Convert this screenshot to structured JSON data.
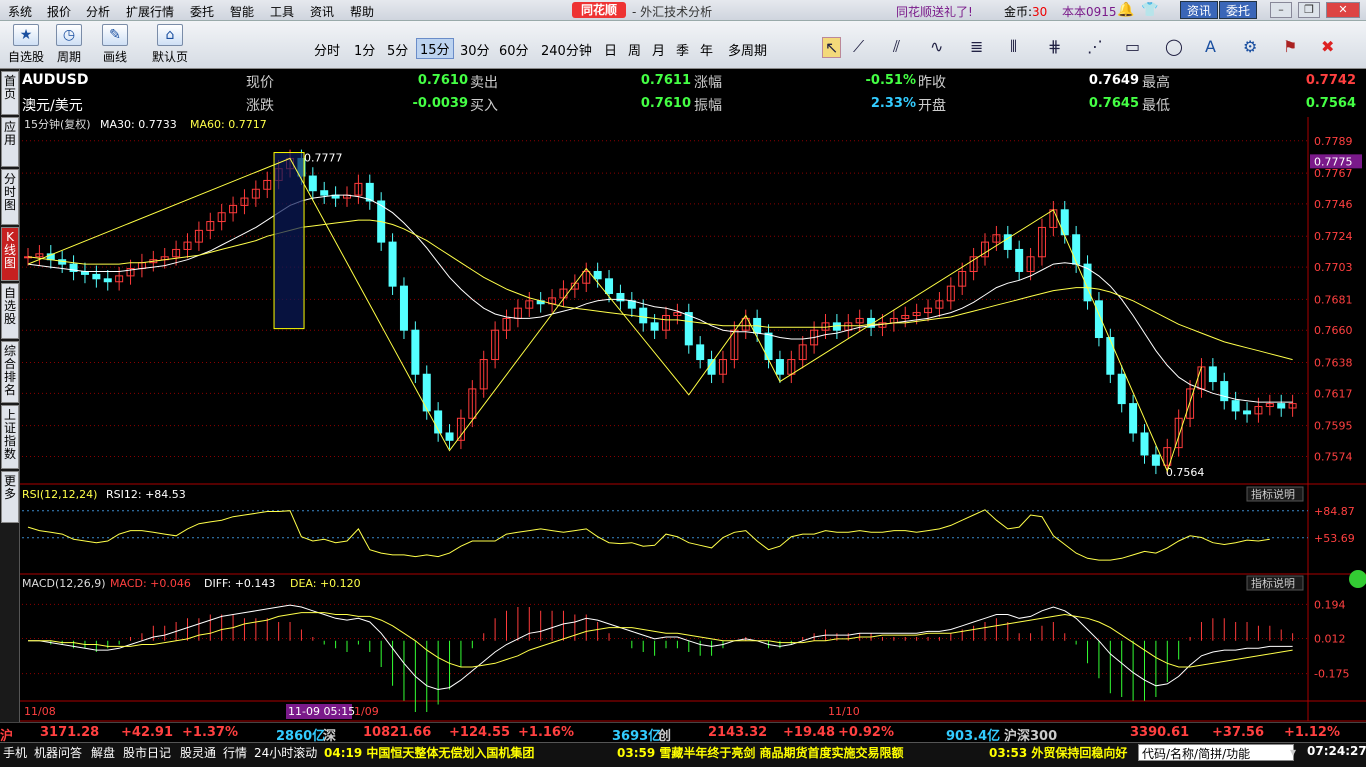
{
  "menu": {
    "items": [
      "系统",
      "报价",
      "分析",
      "扩展行情",
      "委托",
      "智能",
      "工具",
      "资讯",
      "帮助"
    ],
    "logo": "同花顺",
    "title": "- 外汇技术分析",
    "promo": "同花顺送礼了!",
    "gold_label": "金币:",
    "gold_value": "30",
    "version": "本本0915",
    "btn_news": "资讯",
    "btn_trade": "委托"
  },
  "toolbar": {
    "big": [
      {
        "label": "自选股",
        "icon": "star-icon"
      },
      {
        "label": "周期",
        "icon": "clock-icon"
      },
      {
        "label": "画线",
        "icon": "pencil-icon"
      },
      {
        "label": "默认页",
        "icon": "home-icon"
      }
    ],
    "periods": [
      "分时",
      "1分",
      "5分",
      "15分",
      "30分",
      "60分",
      "240分钟",
      "日",
      "周",
      "月",
      "季",
      "年",
      "多周期"
    ],
    "selected_period": "15分"
  },
  "sidebar": [
    "首页",
    "应用",
    "分时图",
    "K线图",
    "自选股",
    "综合排名",
    "上证指数",
    "更多"
  ],
  "quote": {
    "symbol": "AUDUSD",
    "name": "澳元/美元",
    "row1": [
      {
        "label": "现价",
        "value": "0.7610"
      },
      {
        "label": "卖出",
        "value": "0.7611"
      },
      {
        "label": "涨幅",
        "value": "-0.51%"
      },
      {
        "label": "昨收",
        "value": "0.7649"
      },
      {
        "label": "最高",
        "value": "0.7742"
      }
    ],
    "row2": [
      {
        "label": "涨跌",
        "value": "-0.0039"
      },
      {
        "label": "买入",
        "value": "0.7610"
      },
      {
        "label": "振幅",
        "value": "2.33%"
      },
      {
        "label": "开盘",
        "value": "0.7645"
      },
      {
        "label": "最低",
        "value": "0.7564"
      }
    ]
  },
  "chart_data": {
    "type": "candlestick",
    "main": {
      "title": "15分钟(复权)",
      "ma30_label": "MA30: 0.7733",
      "ma60_label": "MA60: 0.7717",
      "yticks": [
        "0.7789",
        "0.7767",
        "0.7746",
        "0.7724",
        "0.7703",
        "0.7681",
        "0.7660",
        "0.7638",
        "0.7617",
        "0.7595",
        "0.7574"
      ],
      "ylim": [
        0.756,
        0.7795
      ],
      "current_price_tag": "0.7775",
      "high_label": "0.7777",
      "low_label": "0.7564",
      "closes": [
        0.771,
        0.7712,
        0.7708,
        0.7705,
        0.77,
        0.7698,
        0.7695,
        0.7693,
        0.7697,
        0.7702,
        0.7706,
        0.7708,
        0.771,
        0.7715,
        0.772,
        0.7728,
        0.7734,
        0.774,
        0.7745,
        0.775,
        0.7756,
        0.7762,
        0.777,
        0.7777,
        0.7765,
        0.7755,
        0.7752,
        0.775,
        0.7752,
        0.776,
        0.7748,
        0.772,
        0.769,
        0.766,
        0.763,
        0.7605,
        0.759,
        0.7585,
        0.76,
        0.762,
        0.764,
        0.766,
        0.7668,
        0.7675,
        0.768,
        0.7678,
        0.7682,
        0.7688,
        0.7692,
        0.77,
        0.7695,
        0.7685,
        0.768,
        0.7675,
        0.7665,
        0.766,
        0.767,
        0.7672,
        0.765,
        0.764,
        0.763,
        0.764,
        0.766,
        0.7668,
        0.7658,
        0.764,
        0.763,
        0.764,
        0.765,
        0.766,
        0.7665,
        0.766,
        0.7665,
        0.7668,
        0.7662,
        0.7665,
        0.7668,
        0.767,
        0.7672,
        0.7675,
        0.768,
        0.769,
        0.77,
        0.771,
        0.772,
        0.7725,
        0.7715,
        0.77,
        0.771,
        0.773,
        0.7742,
        0.7725,
        0.7705,
        0.768,
        0.7655,
        0.763,
        0.761,
        0.759,
        0.7575,
        0.7568,
        0.758,
        0.76,
        0.762,
        0.7635,
        0.7625,
        0.7612,
        0.7605,
        0.7603,
        0.7608,
        0.761,
        0.7607,
        0.761
      ],
      "ma30": [
        0.7705,
        0.7704,
        0.7703,
        0.7702,
        0.7701,
        0.77,
        0.77,
        0.77,
        0.77,
        0.7701,
        0.7702,
        0.7703,
        0.7704,
        0.7706,
        0.7708,
        0.7711,
        0.7714,
        0.7718,
        0.7722,
        0.7726,
        0.773,
        0.7735,
        0.774,
        0.7745,
        0.7748,
        0.775,
        0.7751,
        0.7752,
        0.7752,
        0.7751,
        0.7749,
        0.7745,
        0.774,
        0.7733,
        0.7725,
        0.7716,
        0.7706,
        0.7696,
        0.7688,
        0.7681,
        0.7675,
        0.7671,
        0.7669,
        0.7668,
        0.7668,
        0.7669,
        0.7671,
        0.7673,
        0.7675,
        0.7678,
        0.768,
        0.7681,
        0.7681,
        0.768,
        0.7678,
        0.7676,
        0.7675,
        0.7673,
        0.767,
        0.7667,
        0.7663,
        0.766,
        0.7659,
        0.7659,
        0.7658,
        0.7657,
        0.7655,
        0.7654,
        0.7654,
        0.7655,
        0.7657,
        0.7658,
        0.766,
        0.7662,
        0.7663,
        0.7664,
        0.7665,
        0.7666,
        0.7667,
        0.7668,
        0.767,
        0.7672,
        0.7675,
        0.7679,
        0.7684,
        0.7689,
        0.7692,
        0.7694,
        0.7697,
        0.7701,
        0.7705,
        0.7706,
        0.7705,
        0.7702,
        0.7697,
        0.769,
        0.7681,
        0.767,
        0.7658,
        0.7646,
        0.7636,
        0.7628,
        0.7623,
        0.762,
        0.7617,
        0.7615,
        0.7613,
        0.7612,
        0.7611,
        0.7611,
        0.7611,
        0.7611
      ],
      "ma60": [
        0.771,
        0.7709,
        0.7708,
        0.7707,
        0.7706,
        0.7705,
        0.7705,
        0.7705,
        0.7705,
        0.7706,
        0.7706,
        0.7707,
        0.7708,
        0.7709,
        0.771,
        0.7711,
        0.7713,
        0.7715,
        0.7717,
        0.7719,
        0.7721,
        0.7724,
        0.7726,
        0.7728,
        0.773,
        0.7731,
        0.7732,
        0.7733,
        0.7734,
        0.7735,
        0.7735,
        0.7734,
        0.7732,
        0.7729,
        0.7725,
        0.7721,
        0.7716,
        0.7711,
        0.7706,
        0.7701,
        0.7696,
        0.7692,
        0.7688,
        0.7685,
        0.7682,
        0.768,
        0.7678,
        0.7676,
        0.7675,
        0.7674,
        0.7673,
        0.7672,
        0.7671,
        0.767,
        0.7669,
        0.7668,
        0.7667,
        0.7667,
        0.7666,
        0.7665,
        0.7664,
        0.7663,
        0.7663,
        0.7663,
        0.7663,
        0.7662,
        0.7662,
        0.7662,
        0.7662,
        0.7662,
        0.7662,
        0.7663,
        0.7663,
        0.7663,
        0.7664,
        0.7664,
        0.7665,
        0.7665,
        0.7666,
        0.7667,
        0.7668,
        0.7669,
        0.7671,
        0.7673,
        0.7675,
        0.7677,
        0.7679,
        0.7681,
        0.7683,
        0.7685,
        0.7687,
        0.7688,
        0.7689,
        0.7689,
        0.7688,
        0.7686,
        0.7683,
        0.768,
        0.7676,
        0.7672,
        0.7668,
        0.7664,
        0.7661,
        0.7658,
        0.7655,
        0.7652,
        0.765,
        0.7648,
        0.7646,
        0.7644,
        0.7642,
        0.764
      ]
    },
    "rsi": {
      "label": "RSI(12,12,24)",
      "value_label": "RSI12: +84.53",
      "yticks": [
        "+84.87",
        "+53.69"
      ],
      "ylim": [
        20,
        95
      ],
      "values": [
        66,
        62,
        60,
        58,
        52,
        50,
        48,
        50,
        58,
        62,
        62,
        60,
        58,
        56,
        64,
        70,
        72,
        74,
        78,
        80,
        82,
        84,
        84,
        85,
        55,
        50,
        52,
        48,
        50,
        64,
        40,
        36,
        34,
        34,
        32,
        34,
        32,
        36,
        44,
        50,
        50,
        50,
        58,
        60,
        62,
        64,
        62,
        60,
        62,
        64,
        55,
        48,
        47,
        48,
        44,
        45,
        58,
        55,
        48,
        45,
        42,
        54,
        60,
        62,
        50,
        40,
        44,
        55,
        58,
        58,
        62,
        60,
        60,
        62,
        60,
        60,
        62,
        62,
        60,
        62,
        64,
        68,
        74,
        80,
        86,
        74,
        64,
        66,
        80,
        78,
        56,
        46,
        36,
        30,
        28,
        28,
        30,
        34,
        38,
        36,
        42,
        50,
        56,
        54,
        48,
        46,
        48,
        51,
        50,
        52
      ]
    },
    "macd": {
      "label": "MACD(12,26,9)",
      "macd_label": "MACD: +0.046",
      "diff_label": "DIFF: +0.143",
      "dea_label": "DEA: +0.120",
      "yticks": [
        "0.194",
        "0.012",
        "-0.175"
      ],
      "ylim": [
        -0.3,
        0.26
      ],
      "diff": [
        0.0,
        0.0,
        -0.01,
        -0.02,
        -0.03,
        -0.04,
        -0.05,
        -0.05,
        -0.04,
        -0.02,
        0.0,
        0.02,
        0.03,
        0.05,
        0.07,
        0.09,
        0.11,
        0.13,
        0.14,
        0.15,
        0.16,
        0.17,
        0.18,
        0.19,
        0.18,
        0.16,
        0.14,
        0.12,
        0.11,
        0.12,
        0.1,
        0.04,
        -0.04,
        -0.12,
        -0.19,
        -0.24,
        -0.26,
        -0.25,
        -0.21,
        -0.16,
        -0.11,
        -0.06,
        -0.02,
        0.01,
        0.04,
        0.05,
        0.07,
        0.09,
        0.1,
        0.12,
        0.11,
        0.09,
        0.07,
        0.05,
        0.03,
        0.01,
        0.02,
        0.02,
        0.0,
        -0.02,
        -0.03,
        -0.02,
        0.0,
        0.01,
        0.0,
        -0.02,
        -0.03,
        -0.02,
        0.0,
        0.02,
        0.03,
        0.03,
        0.03,
        0.04,
        0.04,
        0.04,
        0.04,
        0.04,
        0.04,
        0.05,
        0.05,
        0.06,
        0.08,
        0.1,
        0.12,
        0.14,
        0.14,
        0.12,
        0.13,
        0.16,
        0.18,
        0.16,
        0.12,
        0.06,
        0.0,
        -0.07,
        -0.12,
        -0.17,
        -0.21,
        -0.24,
        -0.23,
        -0.19,
        -0.13,
        -0.08,
        -0.06,
        -0.05,
        -0.05,
        -0.04,
        -0.04,
        -0.03,
        -0.03,
        -0.03
      ],
      "dea": [
        0.0,
        0.0,
        0.0,
        -0.01,
        -0.01,
        -0.02,
        -0.02,
        -0.03,
        -0.03,
        -0.03,
        -0.02,
        -0.02,
        -0.01,
        0.0,
        0.01,
        0.03,
        0.04,
        0.06,
        0.07,
        0.09,
        0.1,
        0.11,
        0.13,
        0.14,
        0.15,
        0.15,
        0.15,
        0.14,
        0.14,
        0.13,
        0.13,
        0.11,
        0.08,
        0.04,
        0.0,
        -0.05,
        -0.09,
        -0.12,
        -0.14,
        -0.14,
        -0.13,
        -0.12,
        -0.1,
        -0.08,
        -0.05,
        -0.03,
        -0.01,
        0.01,
        0.03,
        0.05,
        0.06,
        0.07,
        0.07,
        0.07,
        0.06,
        0.05,
        0.04,
        0.04,
        0.03,
        0.02,
        0.01,
        0.0,
        0.0,
        0.0,
        0.0,
        0.0,
        -0.01,
        -0.01,
        -0.01,
        0.0,
        0.0,
        0.01,
        0.01,
        0.02,
        0.02,
        0.03,
        0.03,
        0.03,
        0.03,
        0.04,
        0.04,
        0.04,
        0.05,
        0.06,
        0.07,
        0.08,
        0.09,
        0.1,
        0.11,
        0.12,
        0.13,
        0.14,
        0.13,
        0.12,
        0.1,
        0.07,
        0.03,
        -0.01,
        -0.05,
        -0.09,
        -0.12,
        -0.14,
        -0.14,
        -0.13,
        -0.12,
        -0.11,
        -0.1,
        -0.09,
        -0.08,
        -0.07,
        -0.06,
        -0.05
      ]
    },
    "x_labels": [
      "11/08",
      "11-09 05:15",
      "1/09",
      "11/10"
    ],
    "indicator_btn": "指标说明"
  },
  "status": [
    {
      "t": "沪",
      "c": "#ff4040"
    },
    {
      "t": "3171.28",
      "c": "#ff4040"
    },
    {
      "t": "+42.91",
      "c": "#ff4040"
    },
    {
      "t": "+1.37%",
      "c": "#ff4040"
    },
    {
      "t": "2860亿",
      "c": "#3cf"
    },
    {
      "t": "深",
      "c": "#ccc"
    },
    {
      "t": "10821.66",
      "c": "#ff4040"
    },
    {
      "t": "+124.55",
      "c": "#ff4040"
    },
    {
      "t": "+1.16%",
      "c": "#ff4040"
    },
    {
      "t": "3693亿",
      "c": "#3cf"
    },
    {
      "t": "创",
      "c": "#ccc"
    },
    {
      "t": "2143.32",
      "c": "#ff4040"
    },
    {
      "t": "+19.48",
      "c": "#ff4040"
    },
    {
      "t": "+0.92%",
      "c": "#ff4040"
    },
    {
      "t": "903.4亿",
      "c": "#3cf"
    },
    {
      "t": "沪深300",
      "c": "#ccc"
    },
    {
      "t": "3390.61",
      "c": "#ff4040"
    },
    {
      "t": "+37.56",
      "c": "#ff4040"
    },
    {
      "t": "+1.12%",
      "c": "#ff4040"
    }
  ],
  "bottom": {
    "tabs": [
      "手机",
      "机器问答",
      "解盘",
      "股市日记",
      "股灵通",
      "行情",
      "24小时滚动"
    ],
    "news": [
      "04:19 中国恒天整体无偿划入国机集团",
      "03:59 雪藏半年终于亮剑 商品期货首度实施交易限额",
      "03:53 外贸保持回稳向好"
    ],
    "search_placeholder": "代码/名称/简拼/功能",
    "clock": "07:24:27"
  },
  "colors": {
    "up": "#ff3b3b",
    "down": "#54ffff",
    "ma30": "#ffffff",
    "ma60": "#ffff4a",
    "rsi": "#ffff4a",
    "bg": "#000000",
    "grid": "#8b0000",
    "accent": "#3a66b8"
  }
}
